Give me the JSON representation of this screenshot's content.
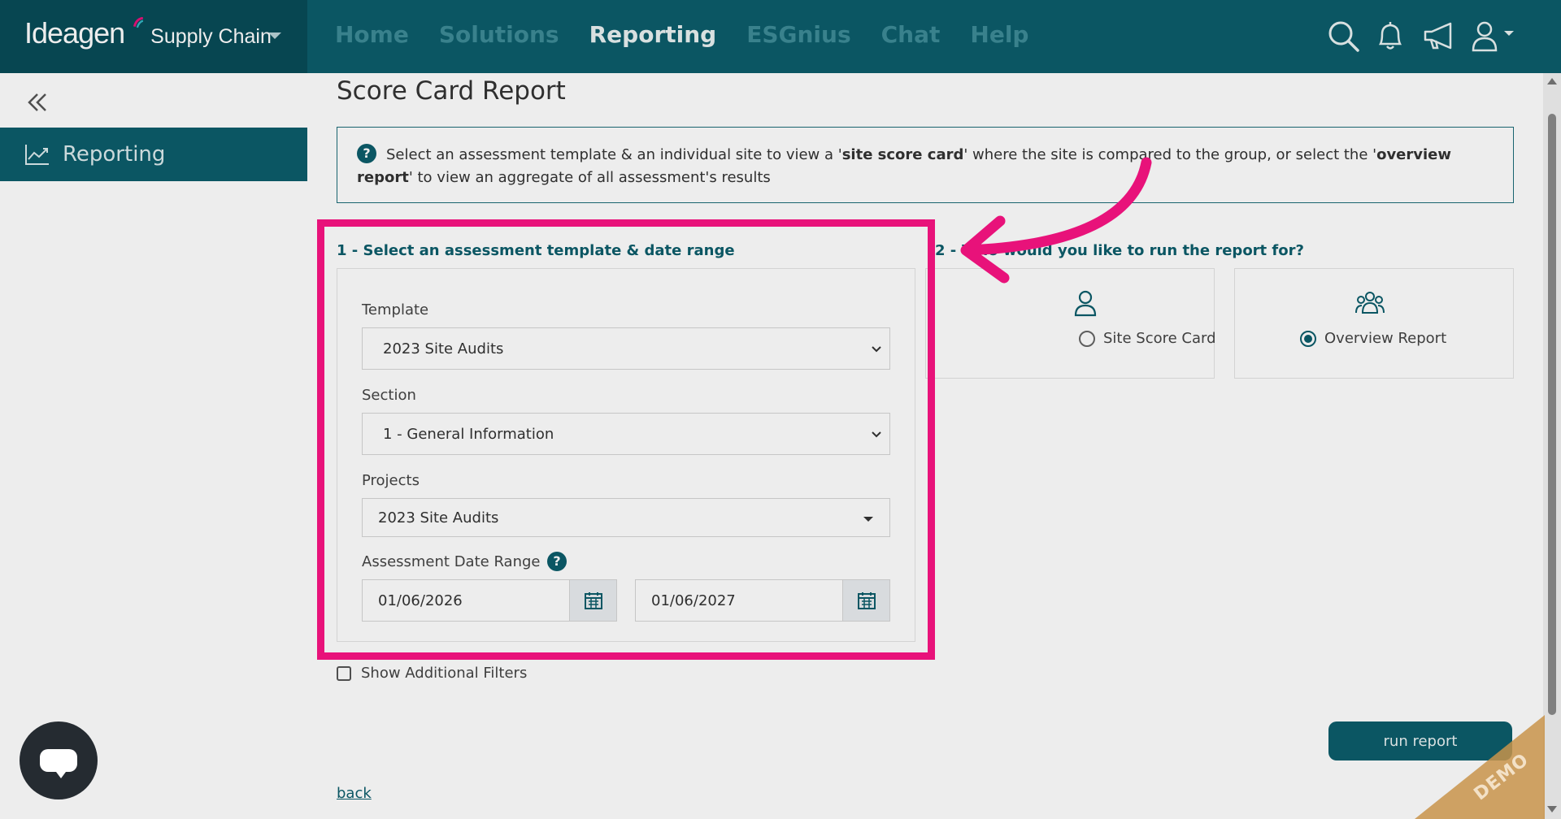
{
  "brand": {
    "logo_text": "Ideagen",
    "product": "Supply Chain"
  },
  "nav": {
    "items": [
      {
        "label": "Home",
        "active": false
      },
      {
        "label": "Solutions",
        "active": false
      },
      {
        "label": "Reporting",
        "active": true
      },
      {
        "label": "ESGnius",
        "active": false
      },
      {
        "label": "Chat",
        "active": false
      },
      {
        "label": "Help",
        "active": false
      }
    ]
  },
  "header_icons": [
    "search-icon",
    "bell-icon",
    "megaphone-icon",
    "user-icon"
  ],
  "sidebar": {
    "items": [
      {
        "label": "Reporting",
        "icon": "chart-line-icon",
        "active": true
      }
    ]
  },
  "page": {
    "title": "Score Card Report",
    "info": {
      "part1": "Select an assessment template & an individual site to view a '",
      "bold1": "site score card",
      "part2": "' where the site is compared to the group, or select the '",
      "bold2": "overview report",
      "part3": "' to view an aggregate of all assessment's results"
    }
  },
  "step1": {
    "heading": "1 - Select an assessment template & date range",
    "template_label": "Template",
    "template_value": "2023 Site Audits",
    "section_label": "Section",
    "section_value": "1 - General Information",
    "projects_label": "Projects",
    "projects_value": "2023 Site Audits",
    "date_range_label": "Assessment Date Range",
    "date_from": "01/06/2026",
    "date_to": "01/06/2027"
  },
  "step2": {
    "heading": "2 - Who would you like to run the report for?",
    "options": [
      {
        "label": "Site Score Card",
        "checked": false,
        "icon": "person-icon"
      },
      {
        "label": "Overview Report",
        "checked": true,
        "icon": "group-icon"
      }
    ]
  },
  "filters": {
    "show_additional_label": "Show Additional Filters",
    "checked": false
  },
  "actions": {
    "run_report": "run report",
    "back": "back"
  },
  "badge": {
    "demo": "DEMO"
  },
  "colors": {
    "primary": "#0c5d6b",
    "highlight": "#e8127a"
  }
}
